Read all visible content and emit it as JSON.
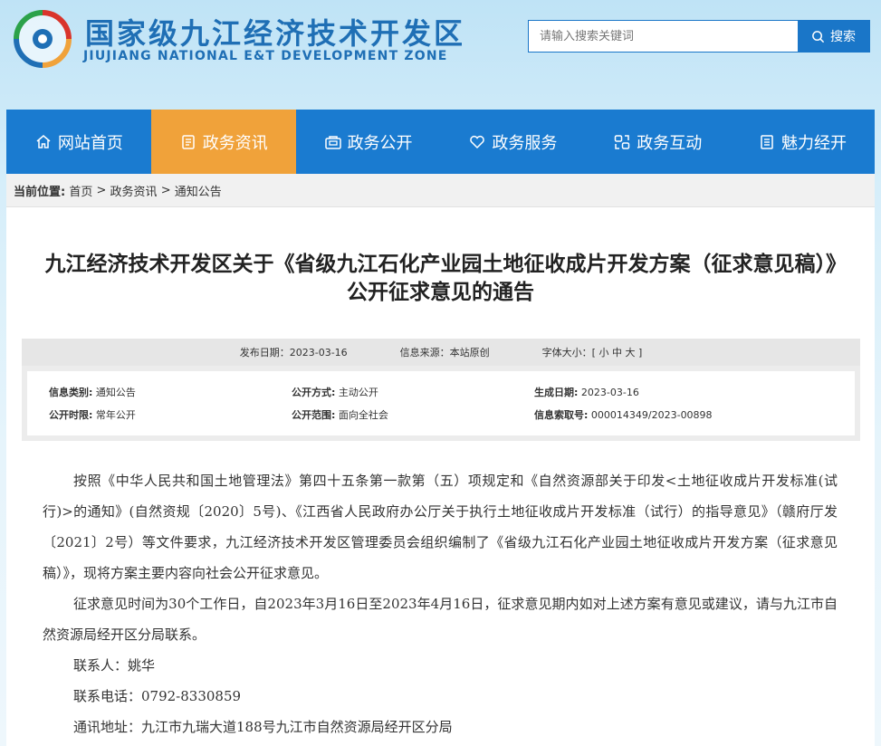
{
  "header": {
    "title": "国家级九江经济技术开发区",
    "subtitle": "JIUJIANG NATIONAL E&T DEVELOPMENT ZONE",
    "logo_icon": "jiujiang-logo-icon",
    "search": {
      "placeholder": "请输入搜索关键词",
      "button_label": "搜索"
    }
  },
  "nav": {
    "items": [
      {
        "label": "网站首页",
        "icon": "home-icon",
        "active": false
      },
      {
        "label": "政务资讯",
        "icon": "document-icon",
        "active": true
      },
      {
        "label": "政务公开",
        "icon": "folder-icon",
        "active": false
      },
      {
        "label": "政务服务",
        "icon": "heart-icon",
        "active": false
      },
      {
        "label": "政务互动",
        "icon": "interact-icon",
        "active": false
      },
      {
        "label": "魅力经开",
        "icon": "list-icon",
        "active": false
      }
    ],
    "colors": {
      "bar": "#1a7bd0",
      "active": "#f0a23a"
    }
  },
  "breadcrumb": {
    "label": "当前位置:",
    "items": [
      "首页",
      "政务资讯",
      "通知公告"
    ],
    "separator": ">"
  },
  "article": {
    "title": "九江经济技术开发区关于《省级九江石化产业园土地征收成片开发方案（征求意见稿）》公开征求意见的通告",
    "meta": {
      "publish_date_label": "发布日期：",
      "publish_date": "2023-03-16",
      "source_label": "信息来源：",
      "source": "本站原创",
      "font_size_label": "字体大小：",
      "font_size_options": "[ 小 中 大 ]"
    },
    "info": {
      "category_label": "信息类别:",
      "category": "通知公告",
      "open_method_label": "公开方式:",
      "open_method": "主动公开",
      "created_date_label": "生成日期:",
      "created_date": "2023-03-16",
      "open_period_label": "公开时限:",
      "open_period": "常年公开",
      "open_scope_label": "公开范围:",
      "open_scope": "面向全社会",
      "index_label": "信息索取号:",
      "index_no": "000014349/2023-00898"
    },
    "paragraphs": [
      "按照《中华人民共和国土地管理法》第四十五条第一款第（五）项规定和《自然资源部关于印发<土地征收成片开发标准(试行)>的通知》(自然资规〔2020〕5号)、《江西省人民政府办公厅关于执行土地征收成片开发标准（试行）的指导意见》（赣府厅发〔2021〕2号）等文件要求，九江经济技术开发区管理委员会组织编制了《省级九江石化产业园土地征收成片开发方案（征求意见稿）》，现将方案主要内容向社会公开征求意见。",
      "征求意见时间为30个工作日，自2023年3月16日至2023年4月16日，征求意见期内如对上述方案有意见或建议，请与九江市自然资源局经开区分局联系。",
      "联系人：姚华",
      "联系电话：0792-8330859",
      "通讯地址：九江市九瑞大道188号九江市自然资源局经开区分局"
    ]
  }
}
